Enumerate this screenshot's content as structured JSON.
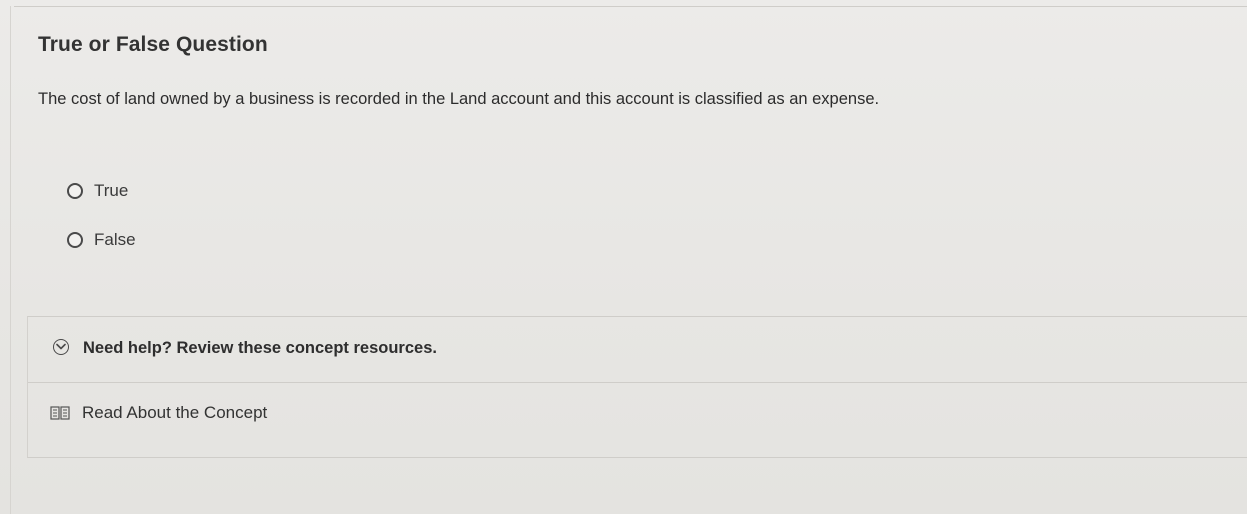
{
  "question": {
    "title": "True or False Question",
    "text": "The cost of land owned by a business is recorded in the Land account and this account is classified as an expense."
  },
  "options": [
    {
      "label": "True",
      "selected": false
    },
    {
      "label": "False",
      "selected": false
    }
  ],
  "help": {
    "title": "Need help? Review these concept resources.",
    "icon": "chevron-down-circle-icon",
    "resources": [
      {
        "label": "Read About the Concept",
        "icon": "book-icon"
      }
    ]
  }
}
